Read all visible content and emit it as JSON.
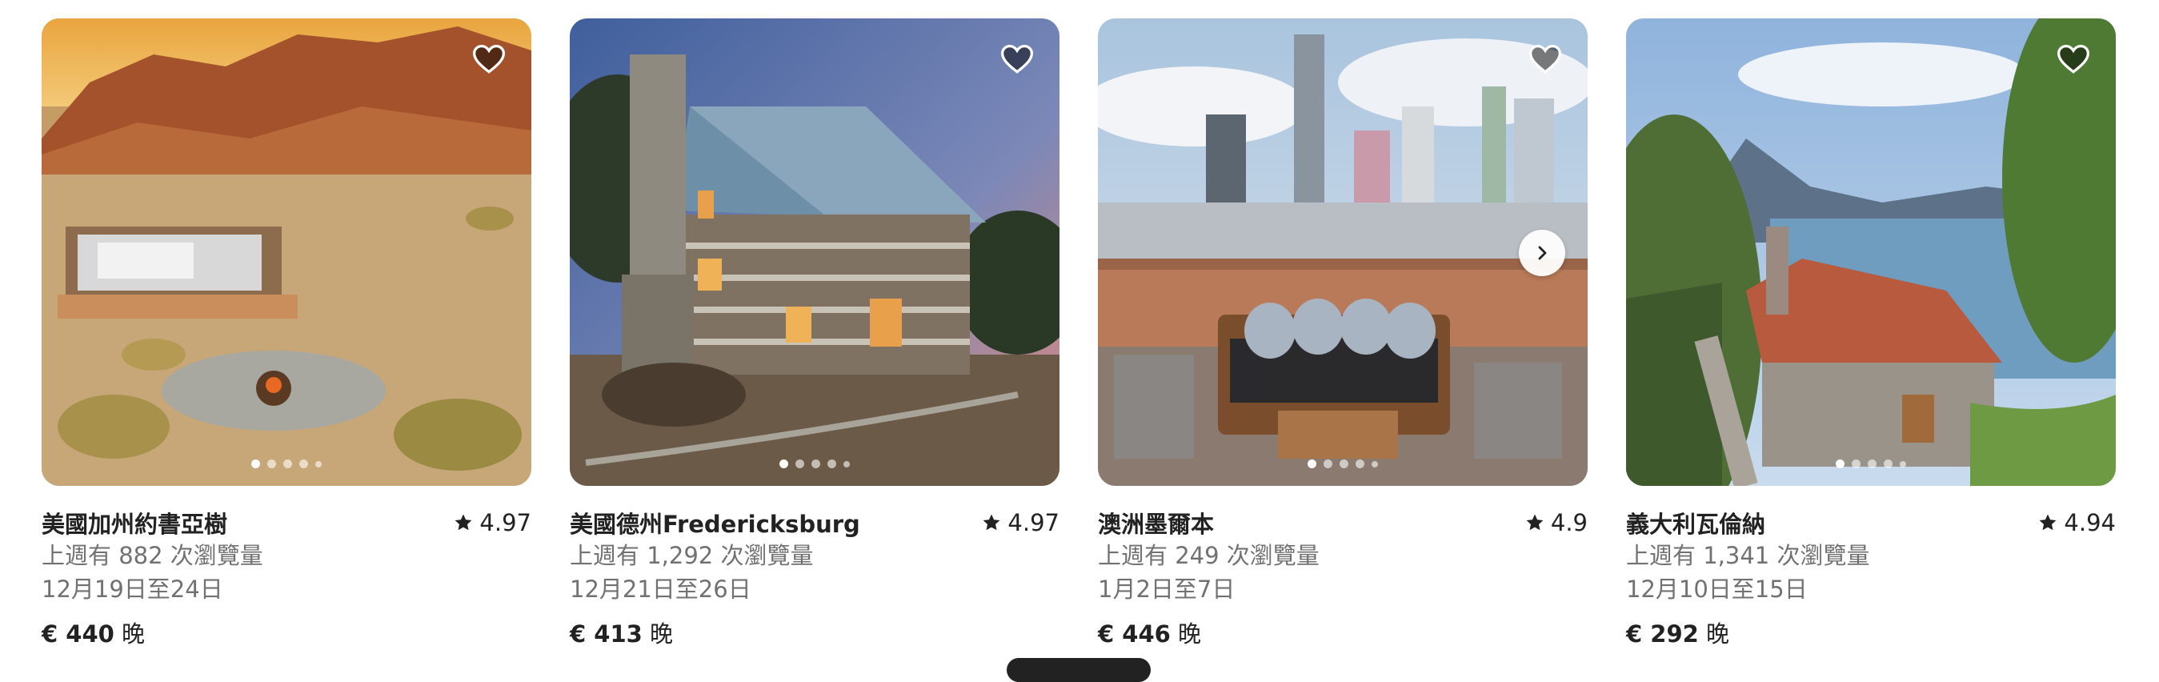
{
  "listings": [
    {
      "title": "美國加州約書亞樹",
      "rating": "4.97",
      "views": "上週有 882 次瀏覽量",
      "dates": "12月19日至24日",
      "price": "€ 440",
      "price_unit": "晚",
      "image": "desert-camp-photo"
    },
    {
      "title": "美國德州Fredericksburg",
      "rating": "4.97",
      "views": "上週有 1,292 次瀏覽量",
      "dates": "12月21日至26日",
      "price": "€ 413",
      "price_unit": "晚",
      "image": "log-cabin-photo"
    },
    {
      "title": "澳洲墨爾本",
      "rating": "4.9",
      "views": "上週有 249 次瀏覽量",
      "dates": "1月2日至7日",
      "price": "€ 446",
      "price_unit": "晚",
      "image": "city-balcony-photo"
    },
    {
      "title": "義大利瓦倫納",
      "rating": "4.94",
      "views": "上週有 1,341 次瀏覽量",
      "dates": "12月10日至15日",
      "price": "€ 292",
      "price_unit": "晚",
      "image": "lake-cottage-photo"
    }
  ],
  "icons": {
    "favorite": "heart-icon",
    "rating": "star-icon",
    "next": "chevron-right-icon"
  }
}
